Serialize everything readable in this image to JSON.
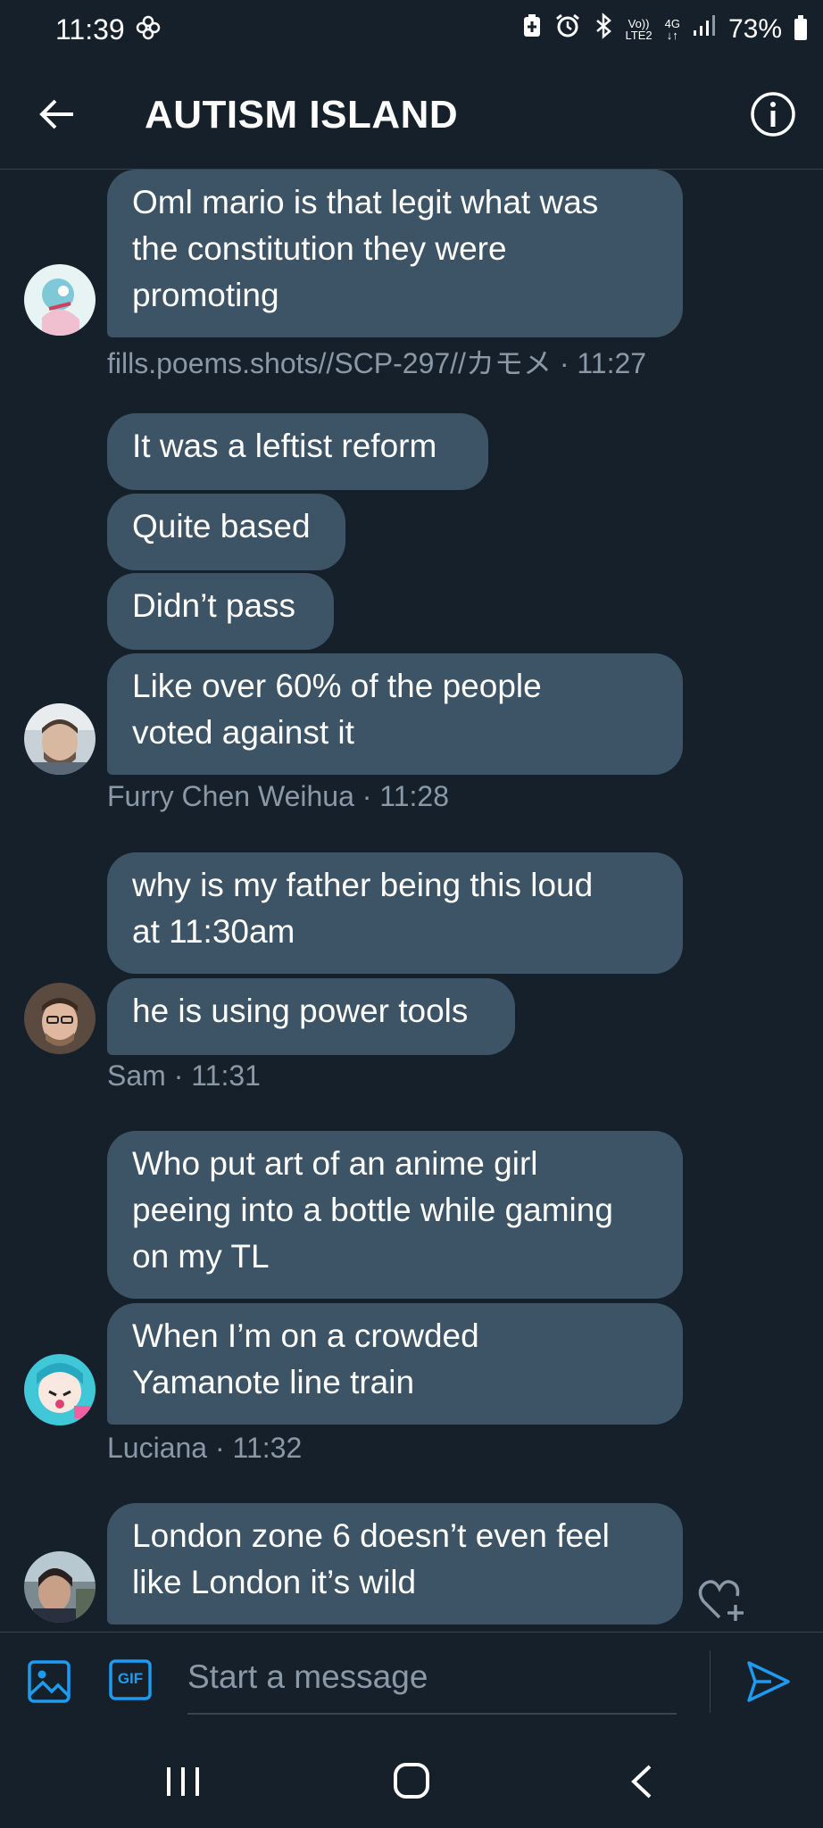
{
  "status_bar": {
    "time": "11:39",
    "battery": "73%",
    "network": "4G",
    "volte_top": "Vo))",
    "volte_bottom": "LTE2",
    "icons": [
      "pinwheel-icon",
      "battery-saver-icon",
      "alarm-icon",
      "bluetooth-icon",
      "signal-icon",
      "battery-icon"
    ]
  },
  "header": {
    "title": "AUTISM ISLAND",
    "icons": [
      "back-arrow-icon",
      "info-icon"
    ]
  },
  "messages": {
    "group1": {
      "bubbles": [
        "Oml mario is that legit what was\nthe constitution they were\npromoting"
      ],
      "meta": "fills.poems.shots//SCP-297//カモメ · 11:27"
    },
    "group2": {
      "bubbles": [
        "It was a leftist reform",
        "Quite based",
        "Didn’t pass",
        "Like over 60% of the people\nvoted against it"
      ],
      "meta": "Furry Chen Weihua · 11:28"
    },
    "group3": {
      "bubbles": [
        "why is my father being this loud\nat 11:30am",
        "he is using power tools"
      ],
      "meta": "Sam · 11:31"
    },
    "group4": {
      "bubbles": [
        "Who put art of an anime girl\npeeing into a bottle while gaming\non my TL",
        "When I’m on a crowded\nYamanote line train"
      ],
      "meta": "Luciana · 11:32"
    },
    "group5": {
      "bubbles": [
        "London zone 6 doesn’t even feel\nlike London it’s wild"
      ]
    }
  },
  "composer": {
    "placeholder": "Start a message",
    "gif_label": "GIF",
    "icons": [
      "image-icon",
      "gif-icon",
      "send-icon"
    ]
  },
  "colors": {
    "background": "#15202b",
    "bubble": "#3d5466",
    "meta_text": "#8b98a5",
    "accent": "#1d9bf0",
    "divider": "#38444d"
  }
}
